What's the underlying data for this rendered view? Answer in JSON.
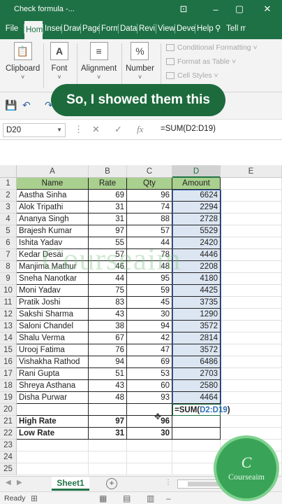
{
  "window": {
    "title": "Check formula  -...",
    "minimize": "–",
    "restore": "▢",
    "close": "✕",
    "save_icon": "save-icon"
  },
  "ribbon_tabs": [
    "File",
    "Hom",
    "Inser",
    "Draw",
    "Page",
    "Form",
    "Data",
    "Revi",
    "View",
    "Deve",
    "Help",
    "Tell m"
  ],
  "ribbon_tabs_active": 1,
  "ribbon_groups": {
    "clipboard": "Clipboard",
    "font": "Font",
    "alignment": "Alignment",
    "number": "Number",
    "number_symbol": "%",
    "styles": [
      "Conditional Formatting ˅",
      "Format as Table ˅",
      "Cell Styles ˅"
    ]
  },
  "caption": "So, I showed them this",
  "formula_bar": {
    "name_box": "D20",
    "cancel": "✕",
    "enter": "✓",
    "fx": "fx",
    "formula": "=SUM(D2:D19)"
  },
  "columns": [
    "A",
    "B",
    "C",
    "D",
    "E"
  ],
  "rows": [
    "1",
    "2",
    "3",
    "4",
    "5",
    "6",
    "7",
    "8",
    "9",
    "10",
    "11",
    "12",
    "13",
    "14",
    "15",
    "16",
    "17",
    "18",
    "19",
    "20",
    "21",
    "22",
    "23",
    "24",
    "25"
  ],
  "table": {
    "headers": [
      "Name",
      "Rate",
      "Qty",
      "Amount"
    ],
    "data": [
      [
        "Aastha Sinha",
        "69",
        "96",
        "6624"
      ],
      [
        "Alok Tripathi",
        "31",
        "74",
        "2294"
      ],
      [
        "Ananya Singh",
        "31",
        "88",
        "2728"
      ],
      [
        "Brajesh Kumar",
        "97",
        "57",
        "5529"
      ],
      [
        "Ishita Yadav",
        "55",
        "44",
        "2420"
      ],
      [
        "Kedar Desai",
        "57",
        "78",
        "4446"
      ],
      [
        "Manjima Mathur",
        "46",
        "48",
        "2208"
      ],
      [
        "Sneha Nanotkar",
        "44",
        "95",
        "4180"
      ],
      [
        "Moni Yadav",
        "75",
        "59",
        "4425"
      ],
      [
        "Pratik Joshi",
        "83",
        "45",
        "3735"
      ],
      [
        "Sakshi Sharma",
        "43",
        "30",
        "1290"
      ],
      [
        "Saloni Chandel",
        "38",
        "94",
        "3572"
      ],
      [
        "Shalu Verma",
        "67",
        "42",
        "2814"
      ],
      [
        "Urooj Fatima",
        "76",
        "47",
        "3572"
      ],
      [
        "Vishakha Rathod",
        "94",
        "69",
        "6486"
      ],
      [
        "Rani Gupta",
        "51",
        "53",
        "2703"
      ],
      [
        "Shreya Asthana",
        "43",
        "60",
        "2580"
      ],
      [
        "Disha Purwar",
        "48",
        "93",
        "4464"
      ]
    ],
    "edit_cell": {
      "prefix": "=SUM(",
      "range": "D2:D19",
      "suffix": ")"
    },
    "summary": [
      [
        "High Rate",
        "97",
        "96"
      ],
      [
        "Low Rate",
        "31",
        "30"
      ]
    ]
  },
  "watermark": "Courseaim",
  "sheet_tab": "Sheet1",
  "add_sheet": "+",
  "status_text": "Ready",
  "logo": {
    "letter": "C",
    "text": "Courseaim"
  },
  "colors": {
    "excel_green": "#1e7145",
    "header_fill": "#a9d08e",
    "amount_fill": "#dce6f2"
  }
}
